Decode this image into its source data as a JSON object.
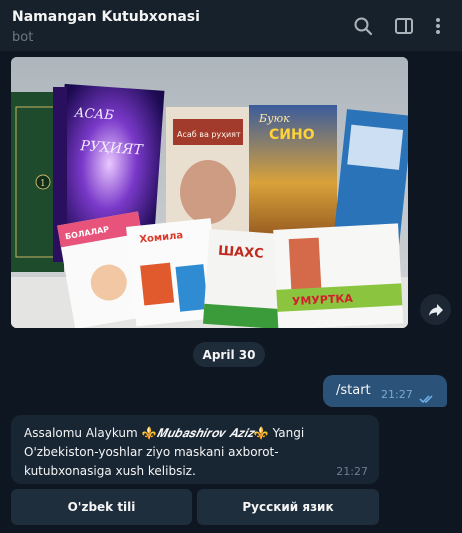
{
  "header": {
    "title": "Namangan Kutubxonasi",
    "subtitle": "bot",
    "icons": [
      "search-icon",
      "sidebar-toggle-icon",
      "more-vertical-icon"
    ]
  },
  "photo": {
    "description_icons": [
      "forward-icon"
    ],
    "book_titles": [
      "АСАБ ва РУҲИЯТ",
      "Асаб ва руҳият",
      "Буюк СИНО",
      "Хомила она бўлиш",
      "БОЛАЛАР ХАСТАЛИКЛАРИ",
      "ШАХС",
      "УМУРТКА — СОҒЛИК КАЛИТИ"
    ]
  },
  "date_separator": "April 30",
  "outgoing": {
    "text": "/start",
    "time": "21:27",
    "status": "read"
  },
  "incoming": {
    "text_part1": "Assalomu Alaykum ",
    "fleur": "⚜️",
    "name": "𝑴𝒖𝒃𝒂𝒔𝒉𝒊𝒓𝒐𝒗 𝑨𝒛𝒊𝒛",
    "text_part2": " Yangi O'zbekiston-yoshlar ziyo maskani axborot-kutubxonasiga xush kelibsiz.",
    "time": "21:27"
  },
  "keyboard": {
    "buttons": [
      "O'zbek tili",
      "Русский язик"
    ]
  },
  "colors": {
    "background": "#0e1621",
    "header": "#17212b",
    "outgoing_bubble": "#2b5278",
    "incoming_bubble": "#182533",
    "keyboard_button": "#1f2e3d"
  }
}
